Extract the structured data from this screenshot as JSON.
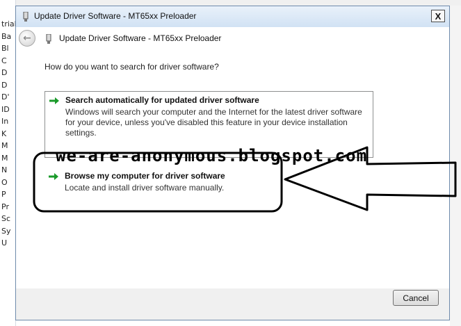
{
  "background": {
    "sidebar_fragments": [
      "trial",
      "Ba",
      "Bl",
      "C",
      "D",
      "D",
      "D'",
      "ID",
      "In",
      "K",
      "M",
      "M",
      "N",
      "O",
      "P",
      "Pr",
      "Sc",
      "Sy",
      "U"
    ]
  },
  "dialog": {
    "window_title": "Update Driver Software - MT65xx Preloader",
    "close_label": "X",
    "nav_title": "Update Driver Software - MT65xx Preloader",
    "back_label": "←",
    "question": "How do you want to search for driver software?",
    "options": [
      {
        "title": "Search automatically for updated driver software",
        "description": "Windows will search your computer and the Internet for the latest driver software for your device, unless you've disabled this feature in your device installation settings."
      },
      {
        "title": "Browse my computer for driver software",
        "description": "Locate and install driver software manually."
      }
    ],
    "cancel_label": "Cancel"
  },
  "annotation": {
    "watermark": "we-are-anonymous.blogspot.com"
  },
  "colors": {
    "accent_arrow": "#1a9a2a",
    "frame": "#c3d8ef"
  },
  "icons": [
    "device-icon",
    "back-arrow-icon",
    "green-arrow-icon"
  ]
}
